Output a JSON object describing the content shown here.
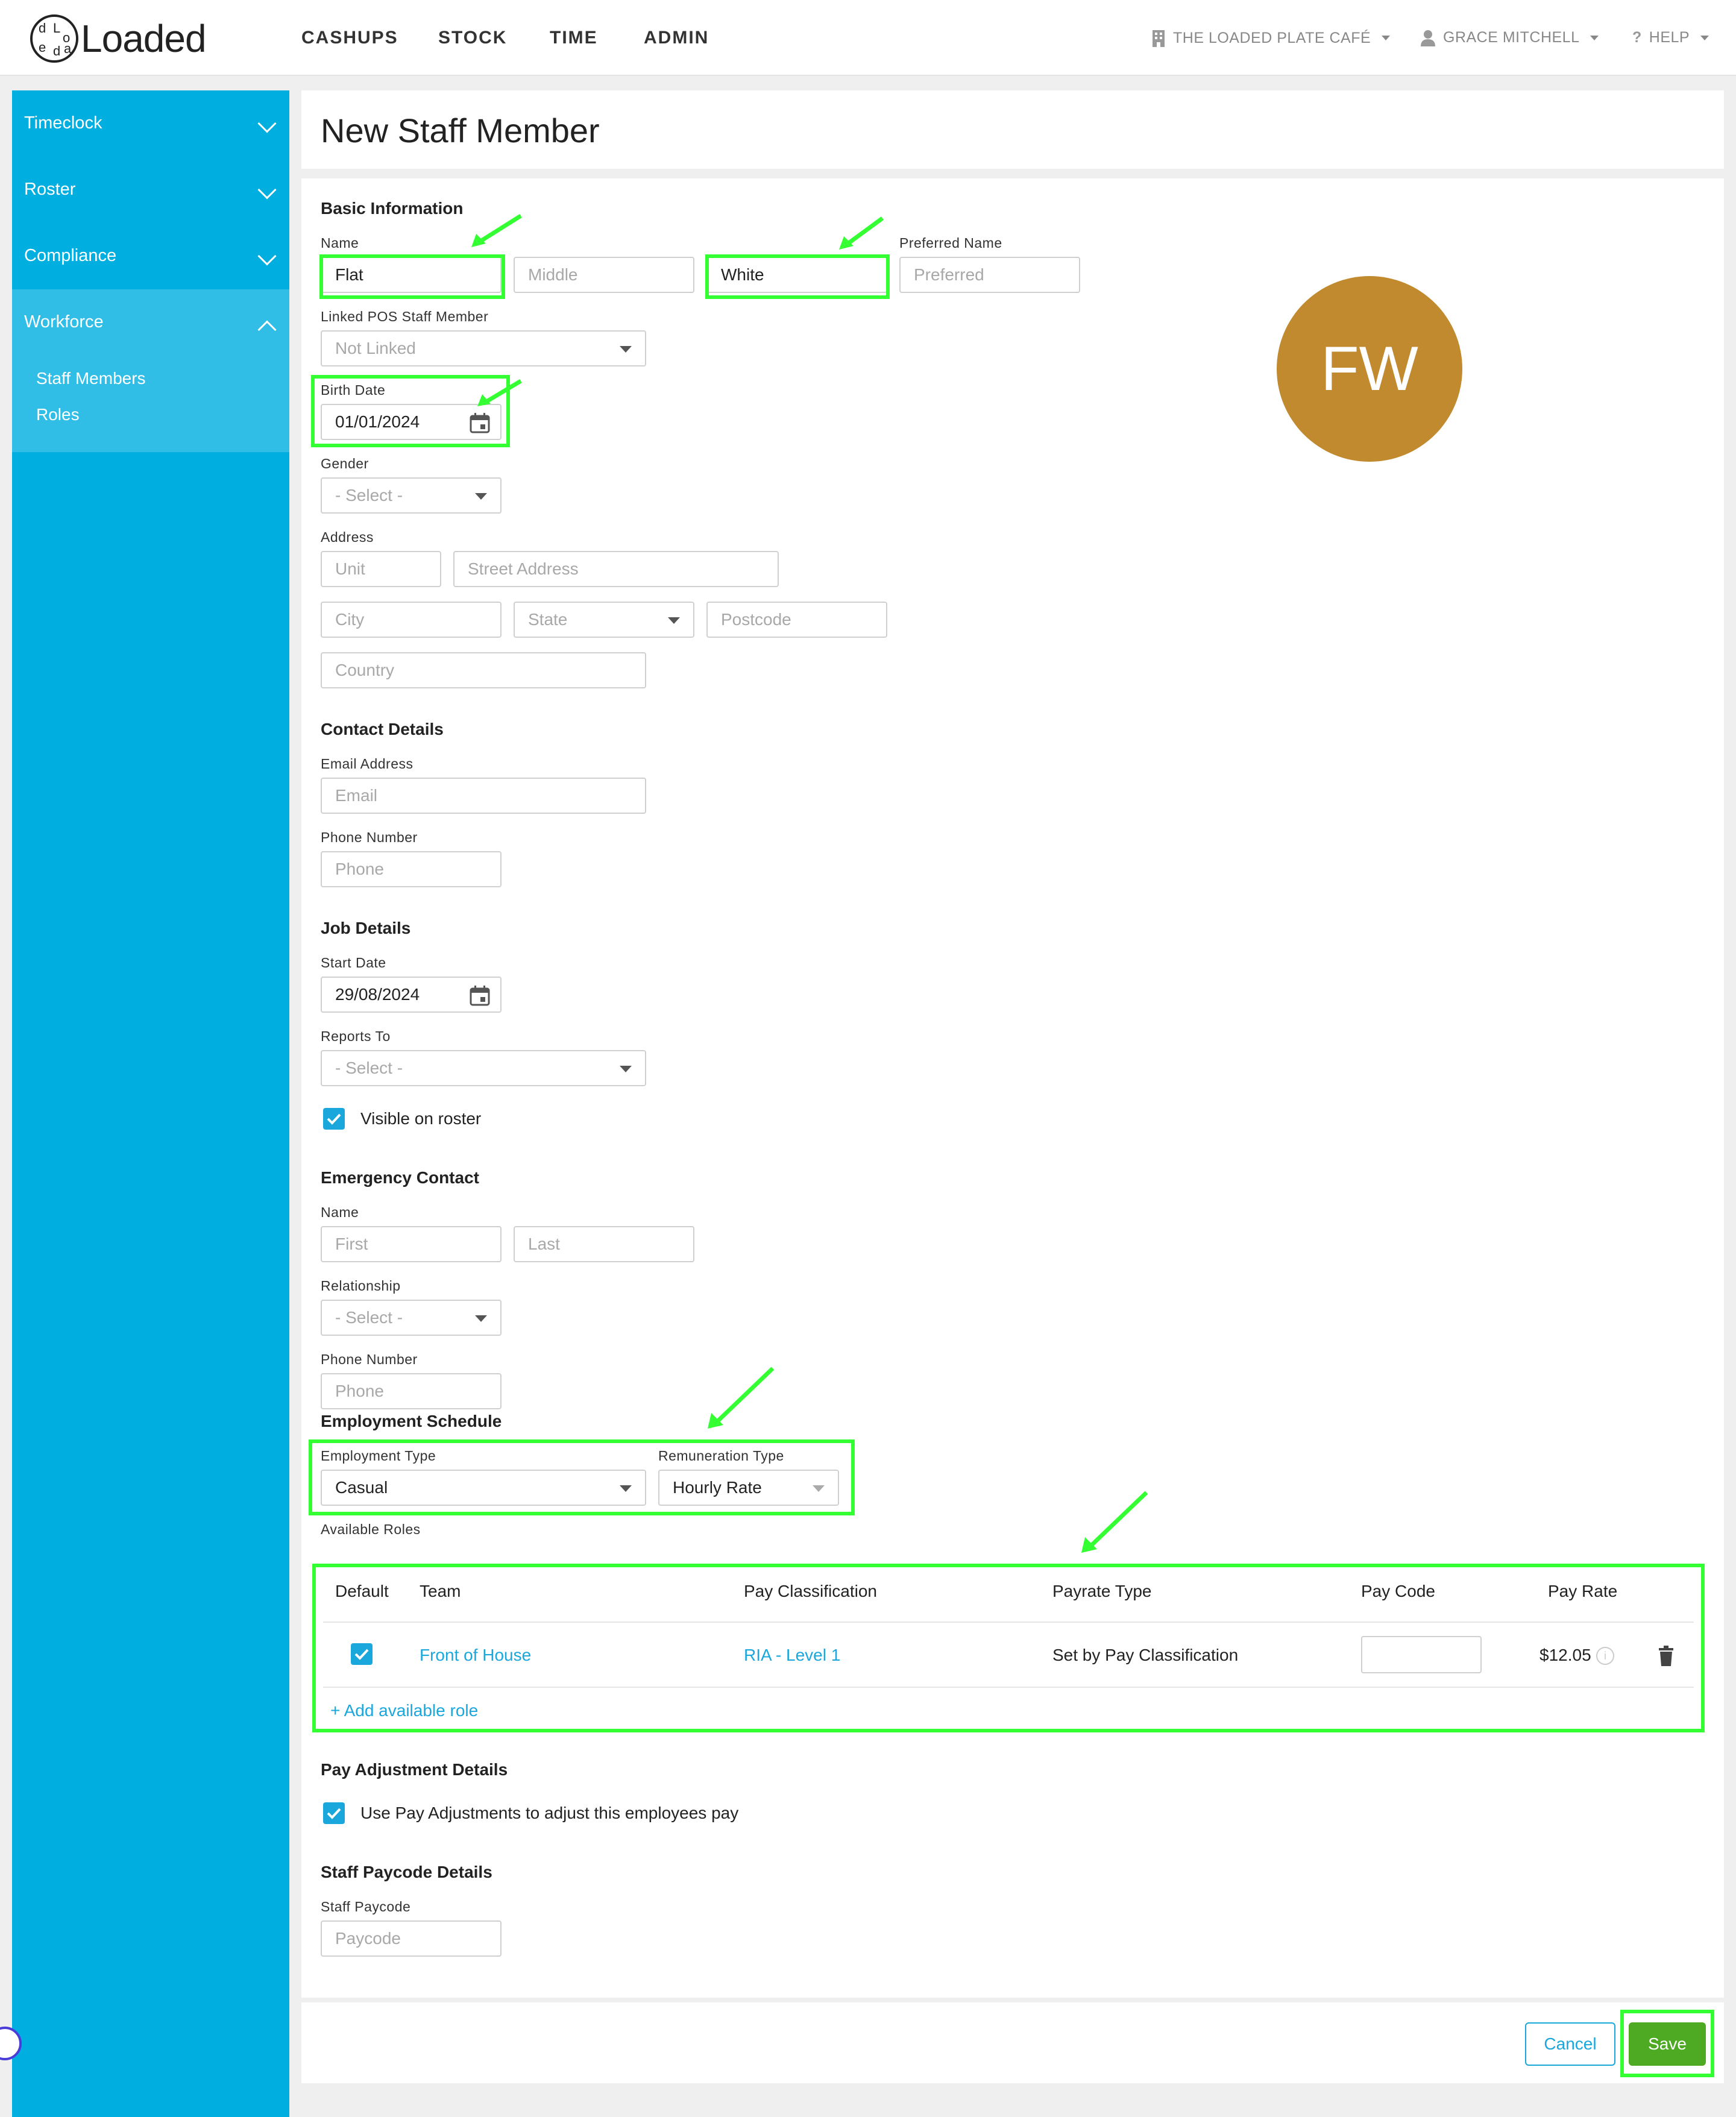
{
  "brand": {
    "logo_text": "Loaded",
    "logo_letters": [
      "d",
      "L",
      "o",
      "e",
      "d",
      "a"
    ]
  },
  "topnav": {
    "items": [
      "CASHUPS",
      "STOCK",
      "TIME",
      "ADMIN"
    ]
  },
  "topright": {
    "venue": "THE LOADED PLATE CAFÉ",
    "user": "GRACE MITCHELL",
    "help_glyph": "?",
    "help": "HELP"
  },
  "sidebar": {
    "items": [
      {
        "label": "Timeclock"
      },
      {
        "label": "Roster"
      },
      {
        "label": "Compliance"
      },
      {
        "label": "Workforce"
      }
    ],
    "sub_items": [
      "Staff Members",
      "Roles"
    ]
  },
  "page": {
    "title": "New Staff Member"
  },
  "basic": {
    "title": "Basic Information",
    "name_label": "Name",
    "first_value": "Flat",
    "middle_placeholder": "Middle",
    "last_value": "White",
    "preferred_label": "Preferred Name",
    "preferred_placeholder": "Preferred",
    "pos_label": "Linked POS Staff Member",
    "pos_value": "Not Linked",
    "birth_label": "Birth Date",
    "birth_value": "01/01/2024",
    "gender_label": "Gender",
    "gender_value": "- Select -",
    "address_label": "Address",
    "unit_placeholder": "Unit",
    "street_placeholder": "Street Address",
    "city_placeholder": "City",
    "state_value": "State",
    "postcode_placeholder": "Postcode",
    "country_placeholder": "Country",
    "avatar_initials": "FW",
    "avatar_color": "#c18a2f"
  },
  "contact": {
    "title": "Contact Details",
    "email_label": "Email Address",
    "email_placeholder": "Email",
    "phone_label": "Phone Number",
    "phone_placeholder": "Phone"
  },
  "job": {
    "title": "Job Details",
    "start_label": "Start Date",
    "start_value": "29/08/2024",
    "reports_label": "Reports To",
    "reports_value": "- Select -",
    "visible_label": "Visible on roster"
  },
  "emergency": {
    "title": "Emergency Contact",
    "name_label": "Name",
    "first_placeholder": "First",
    "last_placeholder": "Last",
    "relationship_label": "Relationship",
    "relationship_value": "- Select -",
    "phone_label": "Phone Number",
    "phone_placeholder": "Phone"
  },
  "schedule": {
    "title": "Employment Schedule",
    "employment_label": "Employment Type",
    "employment_value": "Casual",
    "remuneration_label": "Remuneration Type",
    "remuneration_value": "Hourly Rate",
    "roles_label": "Available Roles",
    "columns": [
      "Default",
      "Team",
      "Pay Classification",
      "Payrate Type",
      "Pay Code",
      "Pay Rate"
    ],
    "rows": [
      {
        "team": "Front of House",
        "classification": "RIA - Level 1",
        "payrate_type": "Set by Pay Classification",
        "pay_code": "",
        "pay_rate": "$12.05",
        "info": "i"
      }
    ],
    "add_role": "+ Add available role"
  },
  "pay_adjust": {
    "title": "Pay Adjustment Details",
    "checkbox_label": "Use Pay Adjustments to adjust this employees pay"
  },
  "paycode": {
    "title": "Staff Paycode Details",
    "label": "Staff Paycode",
    "placeholder": "Paycode"
  },
  "footer": {
    "cancel": "Cancel",
    "save": "Save"
  },
  "colors": {
    "sidebar": "#00aee0",
    "accent": "#1aa7dc",
    "save": "#4eaa22",
    "highlight": "#33ff33"
  }
}
